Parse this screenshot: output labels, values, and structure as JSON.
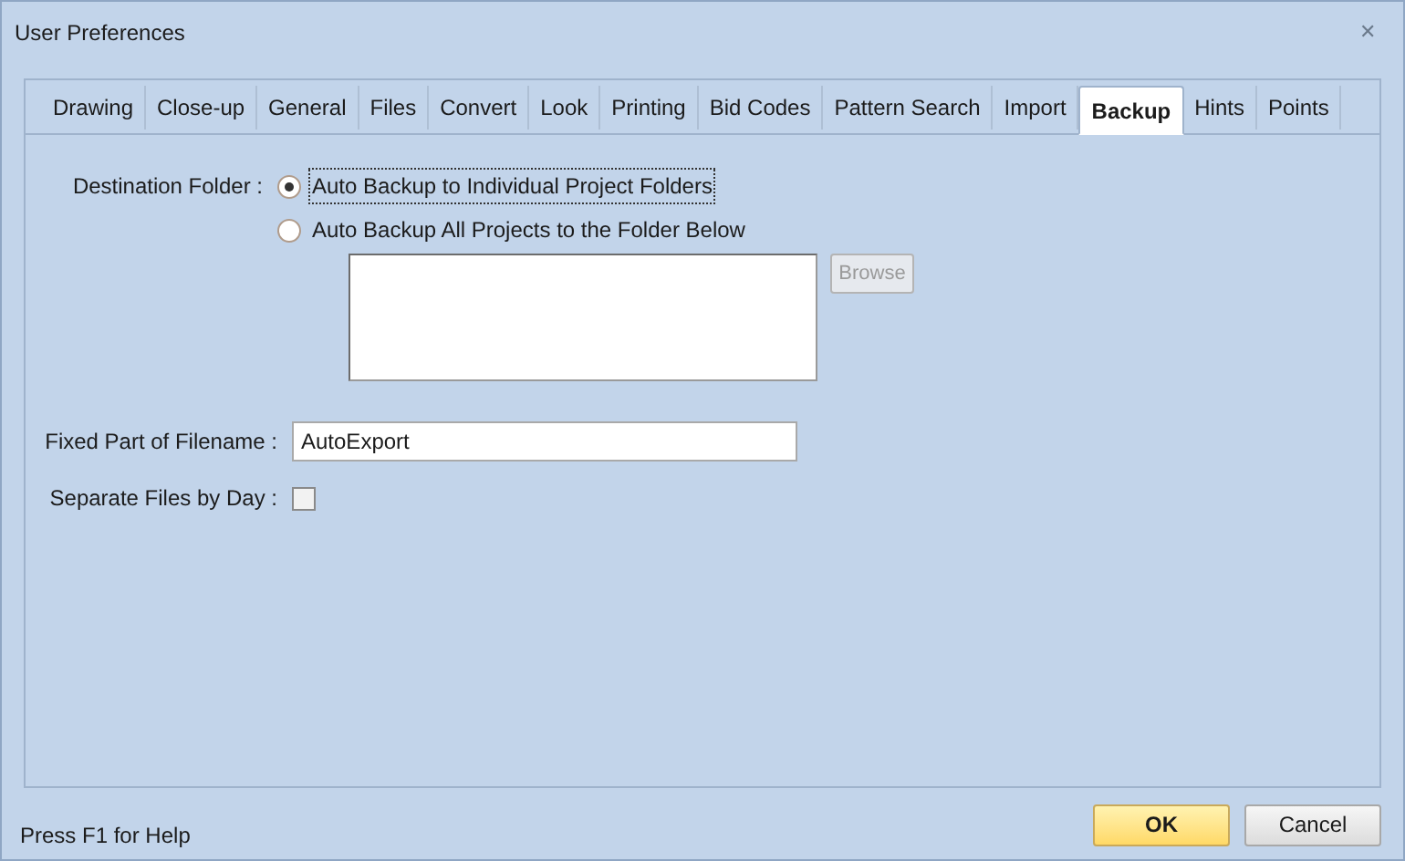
{
  "window": {
    "title": "User Preferences",
    "close": "✕"
  },
  "tabs": [
    {
      "label": "Drawing",
      "selected": false
    },
    {
      "label": "Close-up",
      "selected": false
    },
    {
      "label": "General",
      "selected": false
    },
    {
      "label": "Files",
      "selected": false
    },
    {
      "label": "Convert",
      "selected": false
    },
    {
      "label": "Look",
      "selected": false
    },
    {
      "label": "Printing",
      "selected": false
    },
    {
      "label": "Bid Codes",
      "selected": false
    },
    {
      "label": "Pattern Search",
      "selected": false
    },
    {
      "label": "Import",
      "selected": false
    },
    {
      "label": "Backup",
      "selected": true
    },
    {
      "label": "Hints",
      "selected": false
    },
    {
      "label": "Points",
      "selected": false
    }
  ],
  "destination": {
    "label": "Destination Folder :",
    "options": [
      {
        "label": "Auto Backup to Individual Project Folders",
        "selected": true
      },
      {
        "label": "Auto Backup All Projects to the Folder Below",
        "selected": false
      }
    ],
    "browse": {
      "label": "Browse",
      "disabled": true
    }
  },
  "filename": {
    "label": "Fixed Part of Filename :",
    "value": "AutoExport"
  },
  "separate": {
    "label": "Separate Files by Day :",
    "checked": false
  },
  "status": "Press F1 for Help",
  "buttons": [
    {
      "label": "OK",
      "default": true
    },
    {
      "label": "Cancel",
      "default": false
    }
  ]
}
